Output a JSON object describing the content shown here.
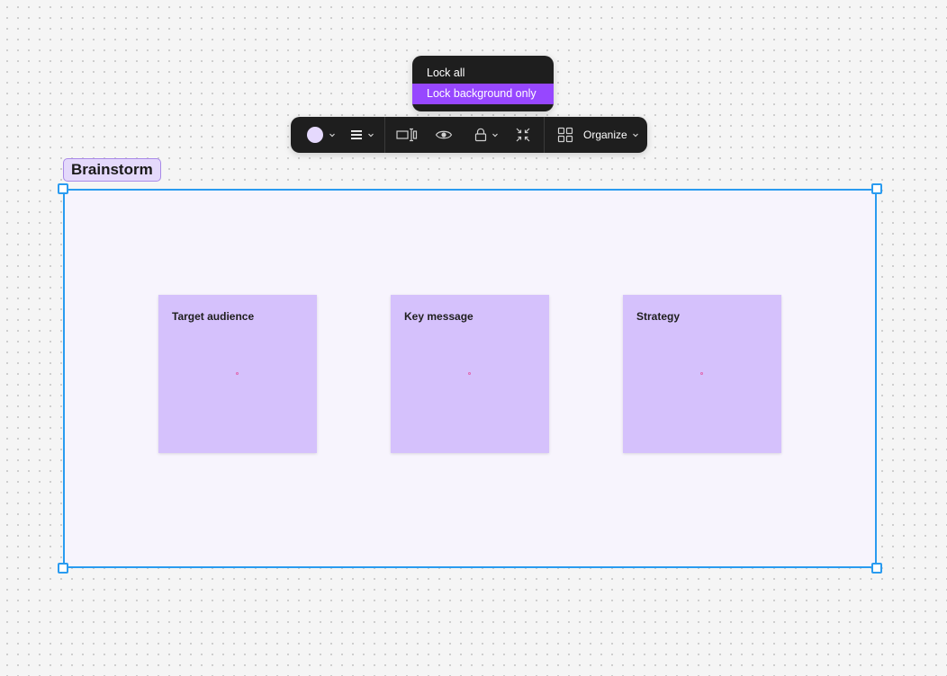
{
  "lock_menu": {
    "items": [
      {
        "label": "Lock all",
        "active": false
      },
      {
        "label": "Lock background only",
        "active": true
      }
    ]
  },
  "toolbar": {
    "tools": [
      {
        "icon": "color-swatch",
        "has_dropdown": true
      },
      {
        "icon": "align-icon",
        "has_dropdown": true
      },
      {
        "icon": "resize-icon",
        "has_dropdown": false
      },
      {
        "icon": "eye-icon",
        "has_dropdown": false
      },
      {
        "icon": "lock-icon",
        "has_dropdown": true
      },
      {
        "icon": "collapse-icon",
        "has_dropdown": false
      },
      {
        "icon": "grid-icon",
        "has_dropdown": true
      }
    ],
    "organize_label": "Organize"
  },
  "section": {
    "title": "Brainstorm",
    "selected": true
  },
  "stickies": [
    {
      "title": "Target audience"
    },
    {
      "title": "Key message"
    },
    {
      "title": "Strategy"
    }
  ],
  "colors": {
    "toolbar_bg": "#1e1e1e",
    "menu_active": "#9747ff",
    "selection": "#2a9bf0",
    "section_fill": "#f7f4fd",
    "section_label_bg": "#e4d9fb",
    "swatch": "#e5d9fd",
    "sticky_fill": "#d5c1fc",
    "canvas_bg": "#f5f5f5"
  }
}
